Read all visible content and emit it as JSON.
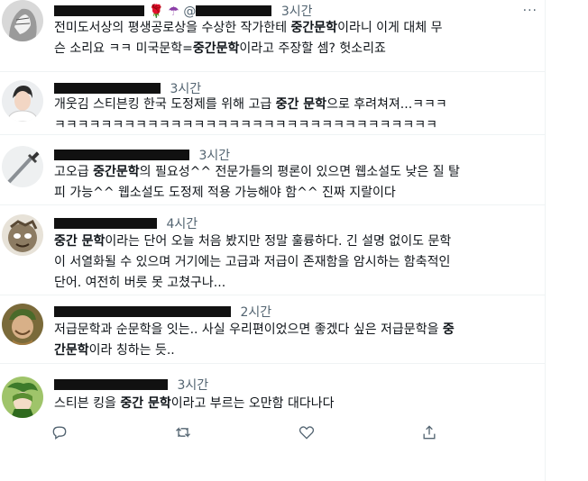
{
  "tweets": [
    {
      "time": "3시간",
      "line1_pre": "전미도서상의 평생공로상을 수상한 작가한테 ",
      "line1_b": "중간문학",
      "line1_post": "이라니 이게 대체 무",
      "line2_pre": "슨 소리요 ㅋㅋ 미국문학=",
      "line2_b": "중간문학",
      "line2_post": "이라고 주장할 셈? 헛소리죠"
    },
    {
      "time": "3시간",
      "line1_pre": "개웃김 스티븐킹 한국 도정제를 위해 고급 ",
      "line1_b": "중간 문학",
      "line1_post": "으로 후려쳐져...ㅋㅋㅋ",
      "line2": "ㅋㅋㅋㅋㅋㅋㅋㅋㅋㅋㅋㅋㅋㅋㅋㅋㅋㅋㅋㅋㅋㅋㅋㅋㅋㅋㅋㅋㅋㅋㅋㅋㅋ"
    },
    {
      "time": "3시간",
      "line1_pre": "고오급 ",
      "line1_b": "중간문학",
      "line1_post": "의 필요성^^ 전문가들의 평론이 있으면 웹소설도 낮은 질 탈",
      "line2": "피 가능^^ 웹소설도 도정제 적용 가능해야 함^^ 진짜 지랄이다"
    },
    {
      "time": "4시간",
      "line1_b": "중간 문학",
      "line1_post": "이라는 단어 오늘 처음 봤지만 정말 훌륭하다. 긴 설명 없이도 문학",
      "line2": "이 서열화될 수 있으며 거기에는 고급과 저급이 존재함을 암시하는 함축적인",
      "line3": "단어. 여전히 버릇 못 고쳤구나..."
    },
    {
      "time": "2시간",
      "line1_pre": "저급문학과 순문학을 잇는.. 사실 우리편이었으면 좋겠다 싶은 저급문학을 ",
      "line1_b": "중",
      "line2_b": "간문학",
      "line2_post": "이라 칭하는 듯.."
    },
    {
      "time": "3시간",
      "line1_pre": "스티븐 킹을 ",
      "line1_b": "중간 문학",
      "line1_post": "이라고 부르는 오만함 대다나다"
    }
  ],
  "header_extra": "@",
  "more_label": "···",
  "icons": [
    "reply-icon",
    "retweet-icon",
    "like-icon",
    "share-icon"
  ]
}
